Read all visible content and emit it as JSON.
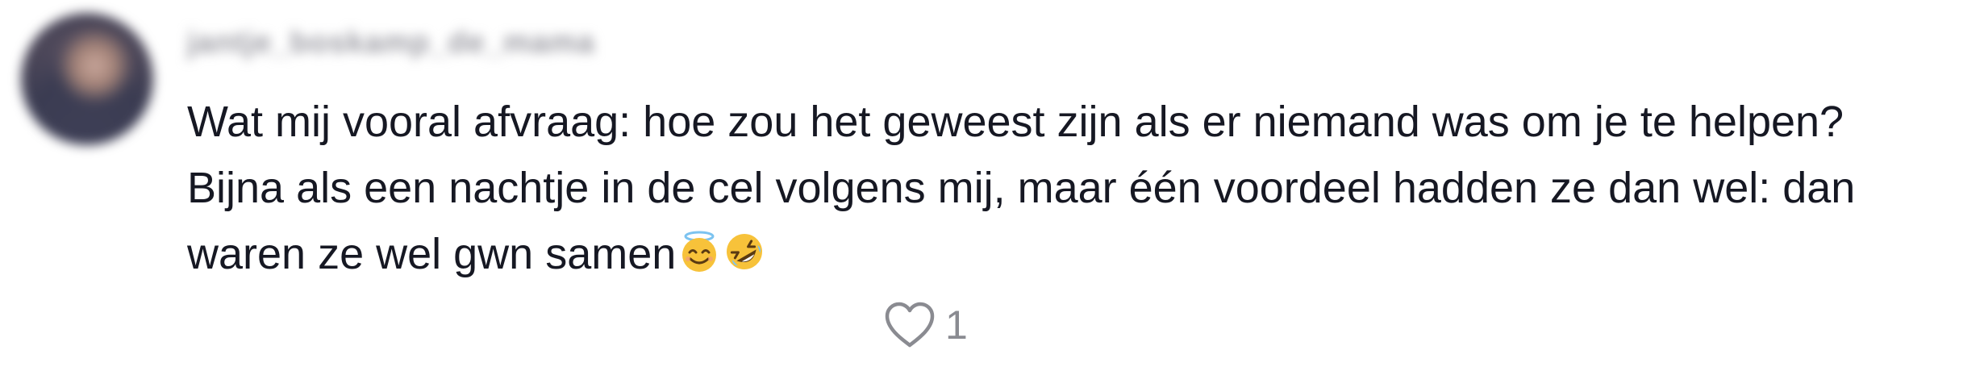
{
  "comment": {
    "username": "jantje_boskamp_de_mama",
    "text": "Wat mij vooral afvraag: hoe zou het geweest zijn als er niemand was om je te helpen? Bijna als een nachtje in de cel volgens mij, maar één voordeel hadden ze dan wel: dan waren ze wel gwn samen",
    "emojis": [
      "smiling-face-with-halo-icon",
      "rolling-on-the-floor-laughing-icon"
    ],
    "like_icon": "heart-outline-icon",
    "like_count": "1"
  },
  "colors": {
    "text": "#161823",
    "muted": "#8a8b91",
    "emoji_yellow": "#f7c23a",
    "halo_blue": "#7cc3f0"
  }
}
